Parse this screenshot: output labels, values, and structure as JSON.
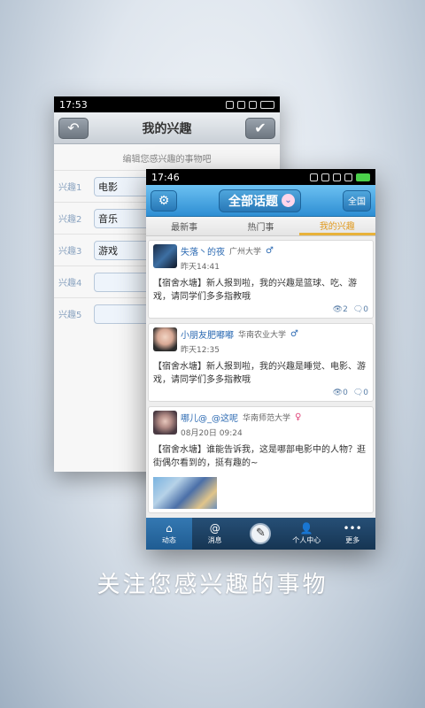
{
  "back_screen": {
    "status_time": "17:53",
    "title": "我的兴趣",
    "back_icon": "arrow-back-icon",
    "confirm_icon": "checkmark-icon",
    "hint": "编辑您感兴趣的事物吧",
    "interests": [
      {
        "label": "兴趣1",
        "value": "电影"
      },
      {
        "label": "兴趣2",
        "value": "音乐"
      },
      {
        "label": "兴趣3",
        "value": "游戏"
      },
      {
        "label": "兴趣4",
        "value": ""
      },
      {
        "label": "兴趣5",
        "value": ""
      }
    ]
  },
  "front_screen": {
    "status_time": "17:46",
    "title": "全部话题",
    "all_button": "全国",
    "tabs": [
      {
        "label": "最新事",
        "active": false
      },
      {
        "label": "热门事",
        "active": true
      },
      {
        "label": "我的兴趣",
        "active": true
      }
    ],
    "posts": [
      {
        "user": "失落丶的夜",
        "school": "广州大学",
        "gender": "♂",
        "time": "昨天14:41",
        "text": "【宿舍水塘】新人报到啦，我的兴趣是篮球、吃、游戏，请同学们多多指教哦",
        "views": "2",
        "comments": "0"
      },
      {
        "user": "小朋友肥嘟嘟",
        "school": "华南农业大学",
        "gender": "♂",
        "time": "昨天12:35",
        "text": "【宿舍水塘】新人报到啦，我的兴趣是睡觉、电影、游戏，请同学们多多指教哦",
        "views": "0",
        "comments": "0"
      },
      {
        "user": "哪儿@_@这呢",
        "school": "华南师范大学",
        "gender": "♀",
        "time": "08月20日 09:24",
        "text": "【宿舍水塘】谁能告诉我，这是哪部电影中的人物？逛街偶尔看到的，挺有趣的~"
      }
    ],
    "nav": [
      {
        "label": "动态",
        "icon": "home-icon"
      },
      {
        "label": "消息",
        "icon": "at-icon"
      },
      {
        "label": "",
        "icon": "compose-icon"
      },
      {
        "label": "个人中心",
        "icon": "person-icon"
      },
      {
        "label": "更多",
        "icon": "more-icon"
      }
    ]
  },
  "caption": "关注您感兴趣的事物",
  "colors": {
    "accent_blue": "#2e8ed3",
    "tab_active": "#e09a1f",
    "nav_bg": "#1f4468"
  }
}
